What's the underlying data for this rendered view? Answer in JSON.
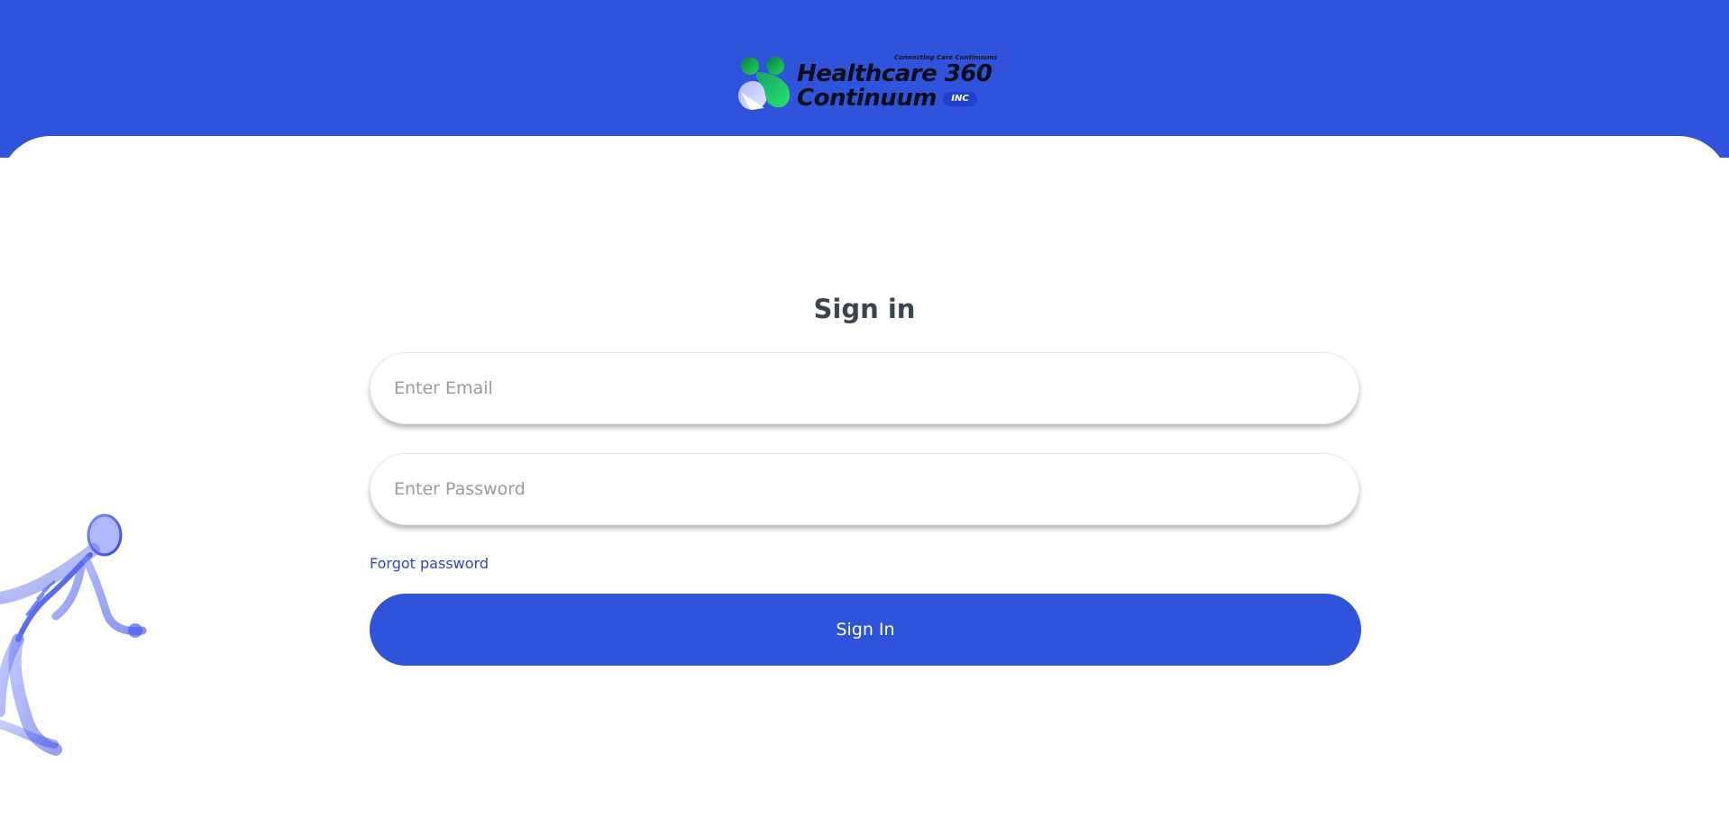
{
  "logo": {
    "tagline": "Connecting Care Continuums",
    "line1": "Healthcare 360",
    "line2": "Continuum",
    "badge": "INC"
  },
  "form": {
    "title": "Sign in",
    "email_placeholder": "Enter Email",
    "password_placeholder": "Enter Password",
    "forgot_label": "Forgot password",
    "submit_label": "Sign In"
  },
  "colors": {
    "brand_blue": "#3053db",
    "link_blue": "#2d47c4",
    "title_gray": "#3c4350",
    "logo_green": "#1fd655"
  },
  "icons": {
    "logo_mark": "healthcare-logo-mark",
    "illustration": "running-skeleton-illustration"
  }
}
